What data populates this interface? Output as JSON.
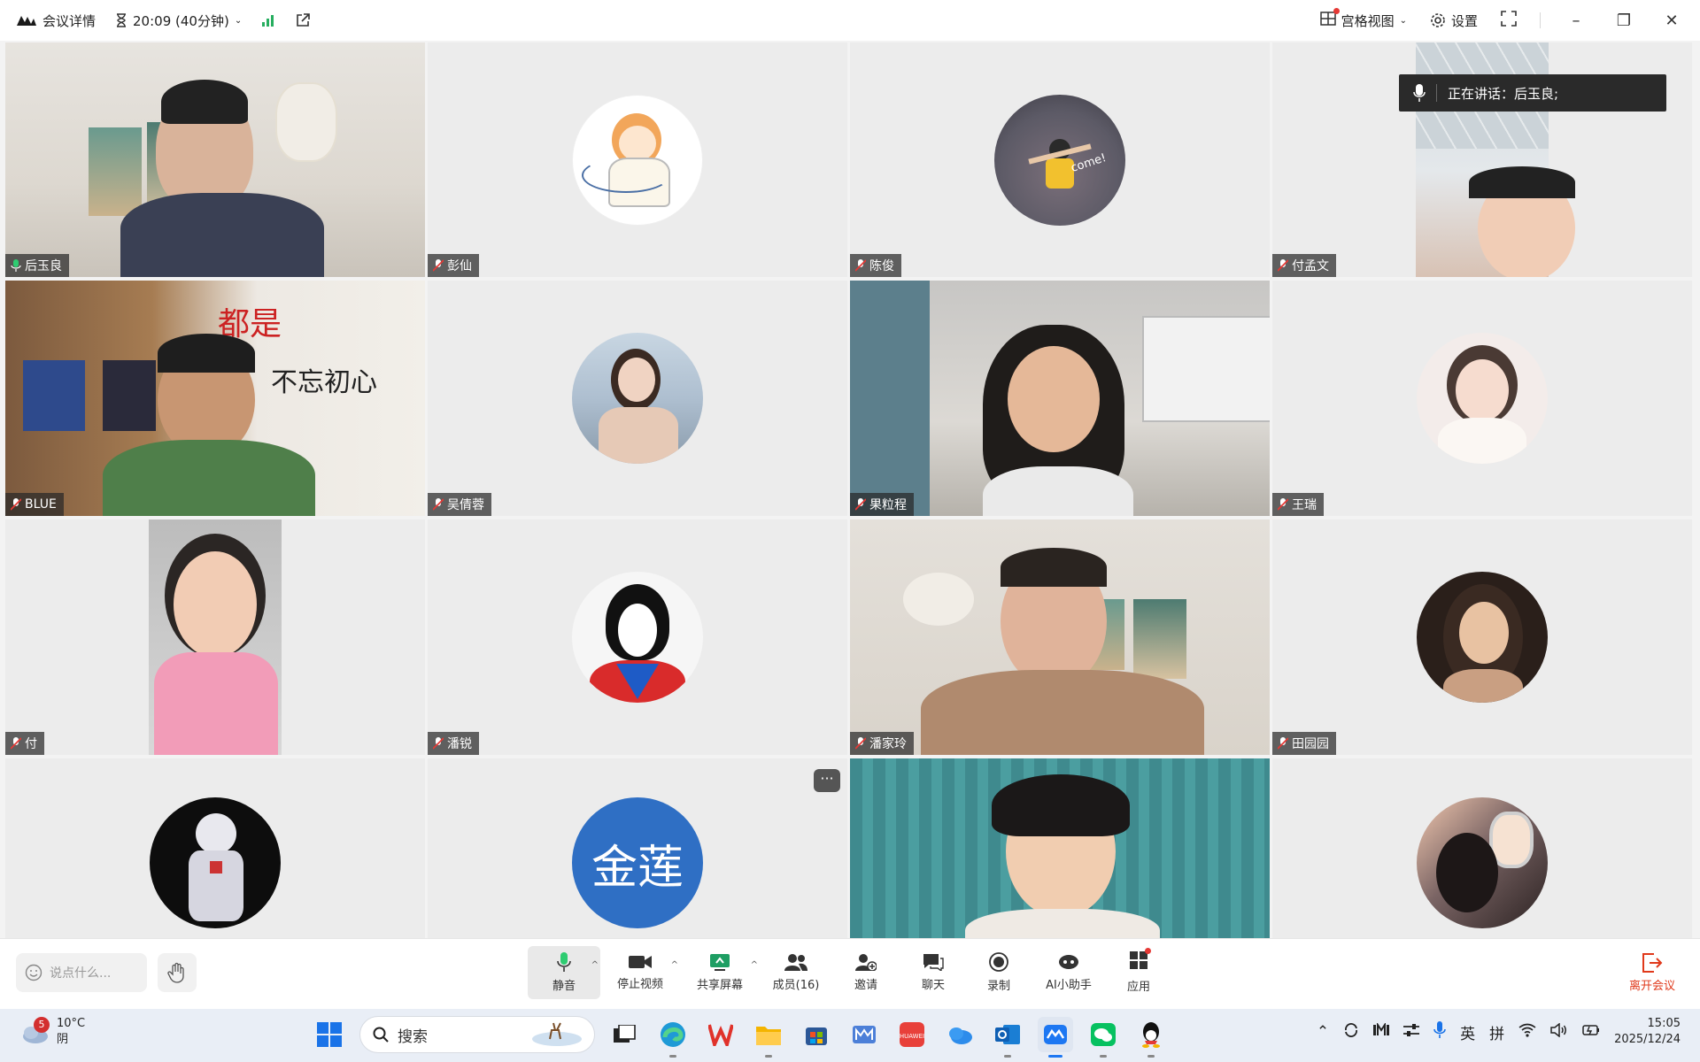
{
  "titlebar": {
    "meeting_details": "会议详情",
    "timer": "20:09 (40分钟)",
    "view_mode": "宫格视图",
    "settings": "设置"
  },
  "speaking": {
    "label": "正在讲话：后玉良;"
  },
  "participants": [
    {
      "name": "后玉良",
      "kind": "video",
      "active": true
    },
    {
      "name": "彭仙",
      "kind": "avatar"
    },
    {
      "name": "陈俊",
      "kind": "avatar"
    },
    {
      "name": "付孟文",
      "kind": "video"
    },
    {
      "name": "BLUE",
      "kind": "video"
    },
    {
      "name": "吴倩蓉",
      "kind": "avatar"
    },
    {
      "name": "果粒程",
      "kind": "video"
    },
    {
      "name": "王瑞",
      "kind": "avatar"
    },
    {
      "name": "付",
      "kind": "video"
    },
    {
      "name": "潘锐",
      "kind": "avatar"
    },
    {
      "name": "潘家玲",
      "kind": "video"
    },
    {
      "name": "田园园",
      "kind": "avatar"
    },
    {
      "name": "",
      "kind": "avatar"
    },
    {
      "name": "",
      "kind": "avatar",
      "initials": "金莲"
    },
    {
      "name": "",
      "kind": "video"
    },
    {
      "name": "",
      "kind": "avatar"
    }
  ],
  "toolbar": {
    "chat_placeholder": "说点什么...",
    "mute": "静音",
    "stop_video": "停止视频",
    "share_screen": "共享屏幕",
    "members": "成员(16)",
    "invite": "邀请",
    "chat": "聊天",
    "record": "录制",
    "ai_assistant": "AI小助手",
    "apps": "应用",
    "leave": "离开会议"
  },
  "taskbar": {
    "weather_temp": "10°C",
    "weather_desc": "阴",
    "weather_badge": "5",
    "search_label": "搜索",
    "ime_lang": "英",
    "ime_mode": "拼",
    "time": "15:05",
    "date": "2025/12/24"
  },
  "colors": {
    "active_speaker": "#2ecc71",
    "leave": "#e0391b",
    "name_tag_bg": "#282828",
    "avatar_blue": "#2f6fc4"
  }
}
